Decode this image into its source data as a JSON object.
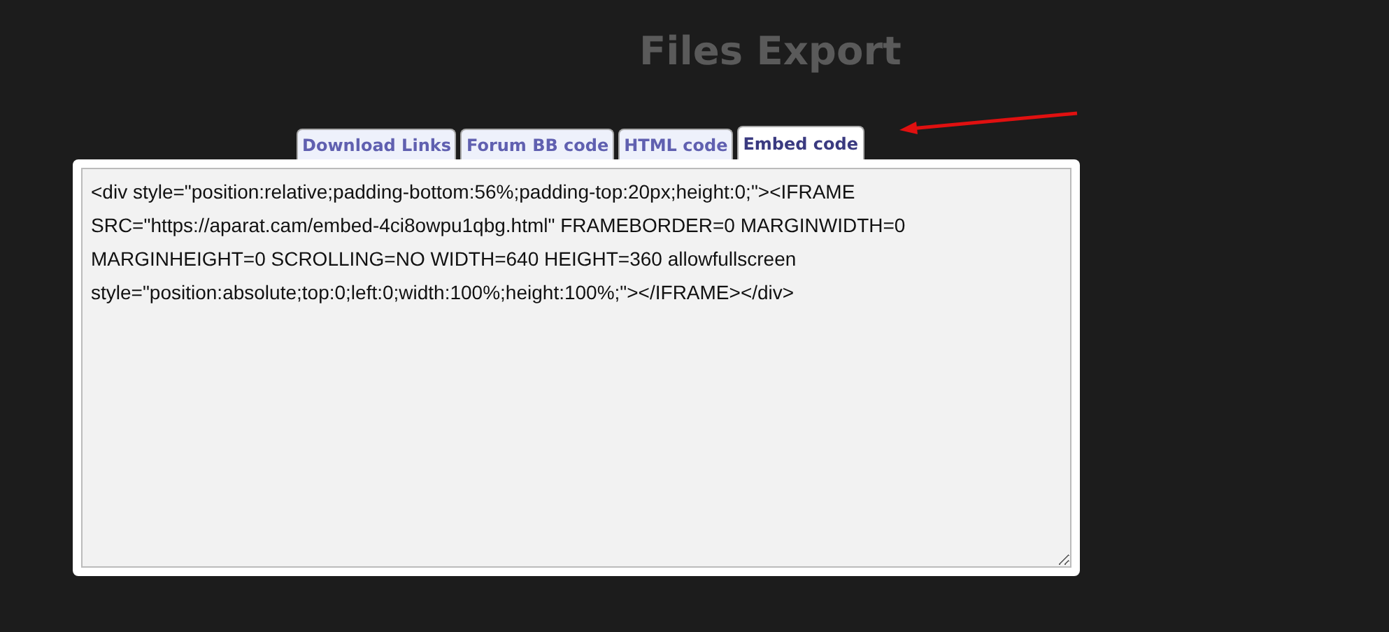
{
  "title": "Files Export",
  "tabs": [
    {
      "label": "Download Links",
      "selected": false
    },
    {
      "label": "Forum BB code",
      "selected": false
    },
    {
      "label": "HTML code",
      "selected": false
    },
    {
      "label": "Embed code",
      "selected": true
    }
  ],
  "code": "<div style=\"position:relative;padding-bottom:56%;padding-top:20px;height:0;\"><IFRAME SRC=\"https://aparat.cam/embed-4ci8owpu1qbg.html\" FRAMEBORDER=0 MARGINWIDTH=0 MARGINHEIGHT=0 SCROLLING=NO WIDTH=640 HEIGHT=360 allowfullscreen style=\"position:absolute;top:0;left:0;width:100%;height:100%;\"></IFRAME></div>"
}
